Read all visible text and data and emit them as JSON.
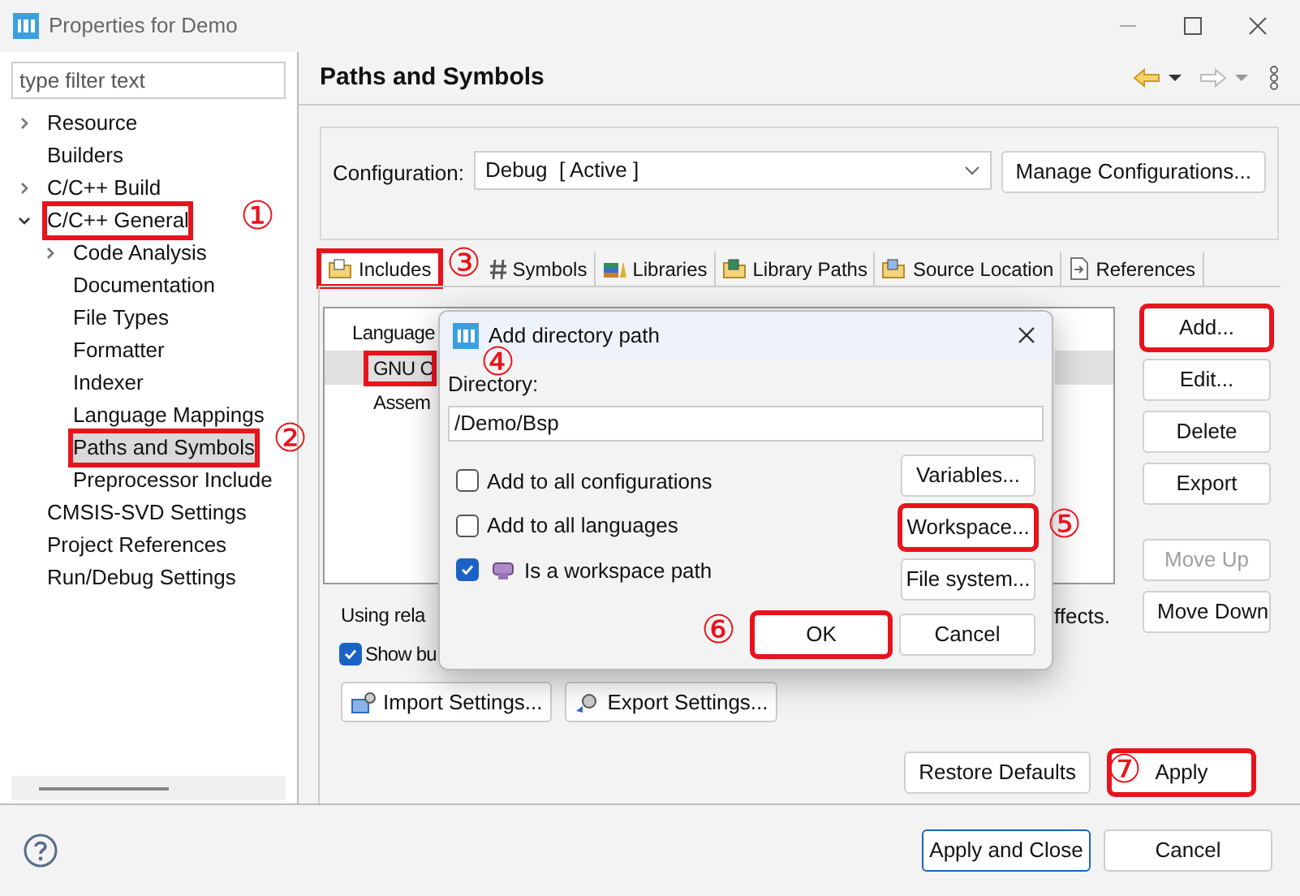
{
  "window": {
    "title": "Properties for Demo"
  },
  "filter": {
    "placeholder": "type filter text"
  },
  "tree": [
    {
      "label": "Resource",
      "expanded": false,
      "selected": false,
      "highlighted": false
    },
    {
      "label": "Builders",
      "selected": false,
      "highlighted": false
    },
    {
      "label": "C/C++ Build",
      "expanded": false,
      "selected": false,
      "highlighted": false
    },
    {
      "label": "C/C++ General",
      "expanded": true,
      "selected": false,
      "highlighted": true,
      "children": [
        {
          "label": "Code Analysis",
          "expanded": false,
          "selected": false,
          "highlighted": false
        },
        {
          "label": "Documentation",
          "selected": false,
          "highlighted": false
        },
        {
          "label": "File Types",
          "selected": false,
          "highlighted": false
        },
        {
          "label": "Formatter",
          "selected": false,
          "highlighted": false
        },
        {
          "label": "Indexer",
          "selected": false,
          "highlighted": false
        },
        {
          "label": "Language Mappings",
          "selected": false,
          "highlighted": false
        },
        {
          "label": "Paths and Symbols",
          "selected": true,
          "highlighted": true
        },
        {
          "label": "Preprocessor Include",
          "selected": false,
          "highlighted": false
        }
      ]
    },
    {
      "label": "CMSIS-SVD Settings",
      "selected": false,
      "highlighted": false
    },
    {
      "label": "Project References",
      "selected": false,
      "highlighted": false
    },
    {
      "label": "Run/Debug Settings",
      "selected": false,
      "highlighted": false
    }
  ],
  "page": {
    "title": "Paths and Symbols",
    "configuration": {
      "label": "Configuration:",
      "value": "Debug  [ Active ]",
      "button": "Manage Configurations..."
    },
    "tabs": [
      {
        "label": "Includes",
        "selected": true,
        "highlighted": true
      },
      {
        "label": "Symbols",
        "selected": false,
        "highlighted": false
      },
      {
        "label": "Libraries",
        "selected": false,
        "highlighted": false
      },
      {
        "label": "Library Paths",
        "selected": false,
        "highlighted": false
      },
      {
        "label": "Source Location",
        "selected": false,
        "highlighted": false
      },
      {
        "label": "References",
        "selected": false,
        "highlighted": false
      }
    ],
    "languages": {
      "header": "Language",
      "rows": [
        {
          "label": "GNU C",
          "selected": true,
          "highlighted": true
        },
        {
          "label": "Assem",
          "selected": false,
          "highlighted": false
        }
      ]
    },
    "side_buttons": [
      {
        "label": "Add...",
        "disabled": false,
        "highlighted": true
      },
      {
        "label": "Edit...",
        "disabled": false,
        "highlighted": false
      },
      {
        "label": "Delete",
        "disabled": false,
        "highlighted": false
      },
      {
        "label": "Export",
        "disabled": false,
        "highlighted": false
      },
      {
        "label": "Move Up",
        "disabled": true,
        "highlighted": false
      },
      {
        "label": "Move Down",
        "disabled": false,
        "highlighted": false
      }
    ],
    "note_start": "Using rela",
    "note_end": "ffects.",
    "show_builtin": {
      "label": "Show bu",
      "checked": true
    },
    "import_button": "Import Settings...",
    "export_button": "Export Settings...",
    "restore_button": {
      "label": "Restore Defaults",
      "highlighted": false
    },
    "apply_button": {
      "label": "Apply",
      "highlighted": true
    }
  },
  "footer": {
    "buttons": [
      {
        "label": "Apply and Close",
        "default": true
      },
      {
        "label": "Cancel",
        "default": false
      }
    ]
  },
  "dialog": {
    "title": "Add directory path",
    "field_label": "Directory:",
    "value": "/Demo/Bsp",
    "options": [
      {
        "label": "Add to all configurations",
        "checked": false
      },
      {
        "label": "Add to all languages",
        "checked": false
      },
      {
        "label": "Is a workspace path",
        "checked": true
      }
    ],
    "side_buttons": [
      {
        "label": "Variables...",
        "highlighted": false
      },
      {
        "label": "Workspace...",
        "highlighted": true
      },
      {
        "label": "File system...",
        "highlighted": false
      }
    ],
    "ok": {
      "label": "OK",
      "highlighted": true
    },
    "cancel": {
      "label": "Cancel",
      "highlighted": false
    }
  },
  "annotations": [
    "①",
    "②",
    "③",
    "④",
    "⑤",
    "⑥",
    "⑦"
  ]
}
